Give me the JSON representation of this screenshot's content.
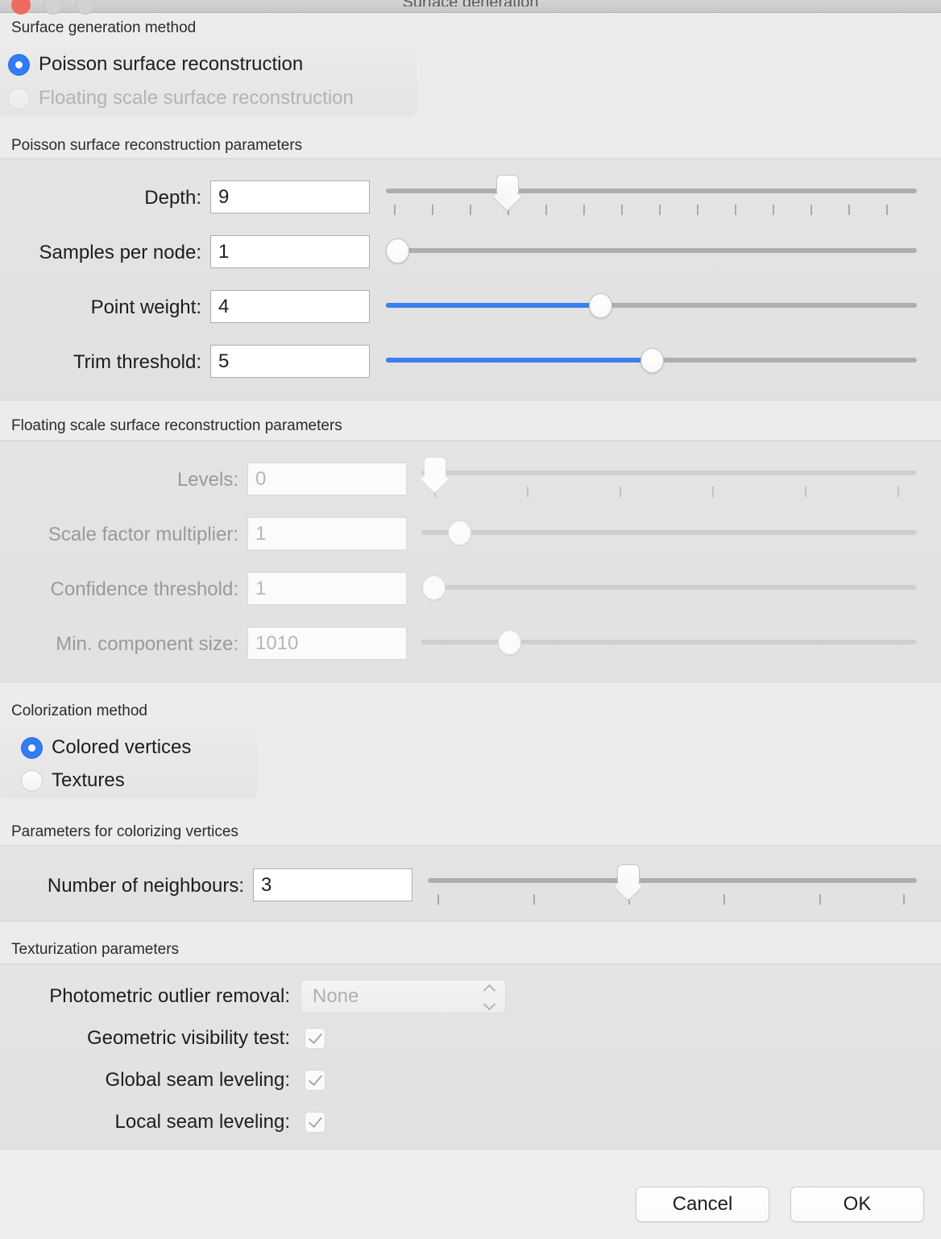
{
  "window": {
    "title": "Surface generation",
    "traffic_lights": [
      "close",
      "minimize",
      "maximize"
    ]
  },
  "sections": {
    "surface_method": {
      "header": "Surface generation method",
      "options": [
        {
          "label": "Poisson surface reconstruction",
          "selected": true,
          "enabled": true
        },
        {
          "label": "Floating scale surface reconstruction",
          "selected": false,
          "enabled": false
        }
      ]
    },
    "poisson_params": {
      "header": "Poisson surface reconstruction parameters",
      "fields": [
        {
          "label": "Depth:",
          "value": "9",
          "enabled": true,
          "slider": {
            "style": "ticked",
            "percent": 22,
            "ticks": 14,
            "filled": false
          }
        },
        {
          "label": "Samples per node:",
          "value": "1",
          "enabled": true,
          "slider": {
            "style": "round",
            "percent": 2,
            "ticks": 0,
            "filled": false
          }
        },
        {
          "label": "Point weight:",
          "value": "4",
          "enabled": true,
          "slider": {
            "style": "round",
            "percent": 40,
            "ticks": 0,
            "filled": true
          }
        },
        {
          "label": "Trim threshold:",
          "value": "5",
          "enabled": true,
          "slider": {
            "style": "round",
            "percent": 50,
            "ticks": 0,
            "filled": true
          }
        }
      ]
    },
    "floating_params": {
      "header": "Floating scale surface reconstruction parameters",
      "fields": [
        {
          "label": "Levels:",
          "value": "0",
          "enabled": false,
          "slider": {
            "style": "ticked",
            "percent": 1,
            "ticks": 6,
            "filled": false
          }
        },
        {
          "label": "Scale factor multiplier:",
          "value": "1",
          "enabled": false,
          "slider": {
            "style": "round",
            "percent": 7,
            "ticks": 0,
            "filled": false
          }
        },
        {
          "label": "Confidence threshold:",
          "value": "1",
          "enabled": false,
          "slider": {
            "style": "round",
            "percent": 2,
            "ticks": 0,
            "filled": false
          }
        },
        {
          "label": "Min. component size:",
          "value": "1010",
          "enabled": false,
          "slider": {
            "style": "round",
            "percent": 17,
            "ticks": 0,
            "filled": false
          }
        }
      ]
    },
    "colorization": {
      "header": "Colorization method",
      "options": [
        {
          "label": "Colored vertices",
          "selected": true,
          "enabled": true
        },
        {
          "label": "Textures",
          "selected": false,
          "enabled": true
        }
      ]
    },
    "colorizing_vertices": {
      "header": "Parameters for colorizing vertices",
      "fields": [
        {
          "label": "Number of neighbours:",
          "value": "3",
          "enabled": true,
          "slider": {
            "style": "ticked",
            "percent": 42,
            "ticks": 6,
            "filled": false
          }
        }
      ]
    },
    "texturization": {
      "header": "Texturization parameters",
      "combo": {
        "label": "Photometric outlier removal:",
        "value": "None",
        "enabled": false
      },
      "checkboxes": [
        {
          "label": "Geometric visibility test:",
          "checked": true,
          "enabled": false
        },
        {
          "label": "Global seam leveling:",
          "checked": true,
          "enabled": false
        },
        {
          "label": "Local seam leveling:",
          "checked": true,
          "enabled": false
        }
      ]
    }
  },
  "footer": {
    "cancel_label": "Cancel",
    "ok_label": "OK"
  },
  "colors": {
    "accent_blue": "#3d7ef0",
    "radio_blue": "#2f7cf6",
    "window_bg": "#ececec",
    "group_bg": "#e2e2e2",
    "disabled_text": "#b3b3b3"
  }
}
